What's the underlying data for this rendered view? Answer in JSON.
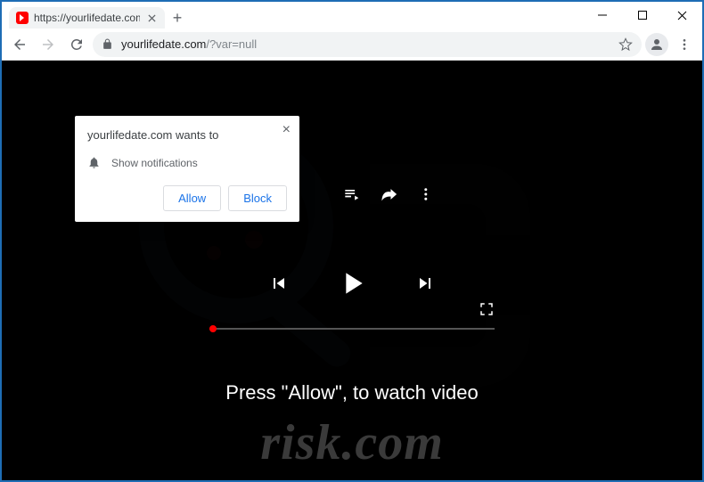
{
  "window": {
    "tab_title": "https://yourlifedate.com/?var=n",
    "url_host": "yourlifedate.com",
    "url_path": "/?var=null"
  },
  "notification": {
    "title": "yourlifedate.com wants to",
    "permission_label": "Show notifications",
    "allow": "Allow",
    "block": "Block"
  },
  "page": {
    "instruction": "Press \"Allow\", to watch video"
  },
  "watermark": {
    "text": "risk.com"
  }
}
